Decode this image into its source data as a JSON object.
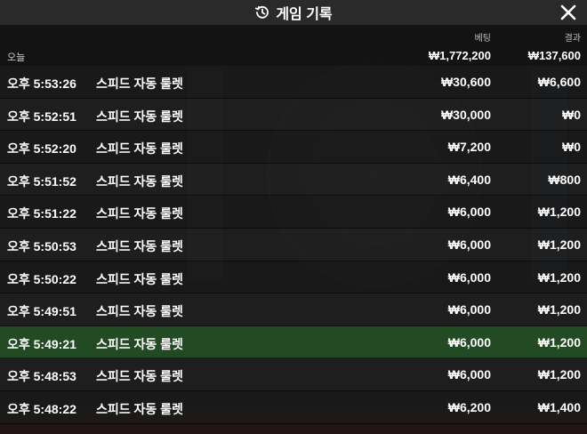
{
  "header": {
    "title": "게임 기록",
    "history_icon": "history-clock-icon",
    "close_icon": "close-icon"
  },
  "columns": {
    "today": "오늘",
    "bet_label": "베팅",
    "result_label": "결과",
    "bet_total": "₩1,772,200",
    "result_total": "₩137,600"
  },
  "rows": [
    {
      "time": "오후 5:53:26",
      "game": "스피드 자동 룰렛",
      "bet": "₩30,600",
      "result": "₩6,600"
    },
    {
      "time": "오후 5:52:51",
      "game": "스피드 자동 룰렛",
      "bet": "₩30,000",
      "result": "₩0"
    },
    {
      "time": "오후 5:52:20",
      "game": "스피드 자동 룰렛",
      "bet": "₩7,200",
      "result": "₩0"
    },
    {
      "time": "오후 5:51:52",
      "game": "스피드 자동 룰렛",
      "bet": "₩6,400",
      "result": "₩800"
    },
    {
      "time": "오후 5:51:22",
      "game": "스피드 자동 룰렛",
      "bet": "₩6,000",
      "result": "₩1,200"
    },
    {
      "time": "오후 5:50:53",
      "game": "스피드 자동 룰렛",
      "bet": "₩6,000",
      "result": "₩1,200"
    },
    {
      "time": "오후 5:50:22",
      "game": "스피드 자동 룰렛",
      "bet": "₩6,000",
      "result": "₩1,200"
    },
    {
      "time": "오후 5:49:51",
      "game": "스피드 자동 룰렛",
      "bet": "₩6,000",
      "result": "₩1,200"
    },
    {
      "time": "오후 5:49:21",
      "game": "스피드 자동 룰렛",
      "bet": "₩6,000",
      "result": "₩1,200"
    },
    {
      "time": "오후 5:48:53",
      "game": "스피드 자동 룰렛",
      "bet": "₩6,000",
      "result": "₩1,200"
    },
    {
      "time": "오후 5:48:22",
      "game": "스피드 자동 룰렛",
      "bet": "₩6,200",
      "result": "₩1,400"
    }
  ],
  "colors": {
    "header_bg": "#2a2a2a",
    "highlight_row": "#265828",
    "text": "#ffffff"
  }
}
